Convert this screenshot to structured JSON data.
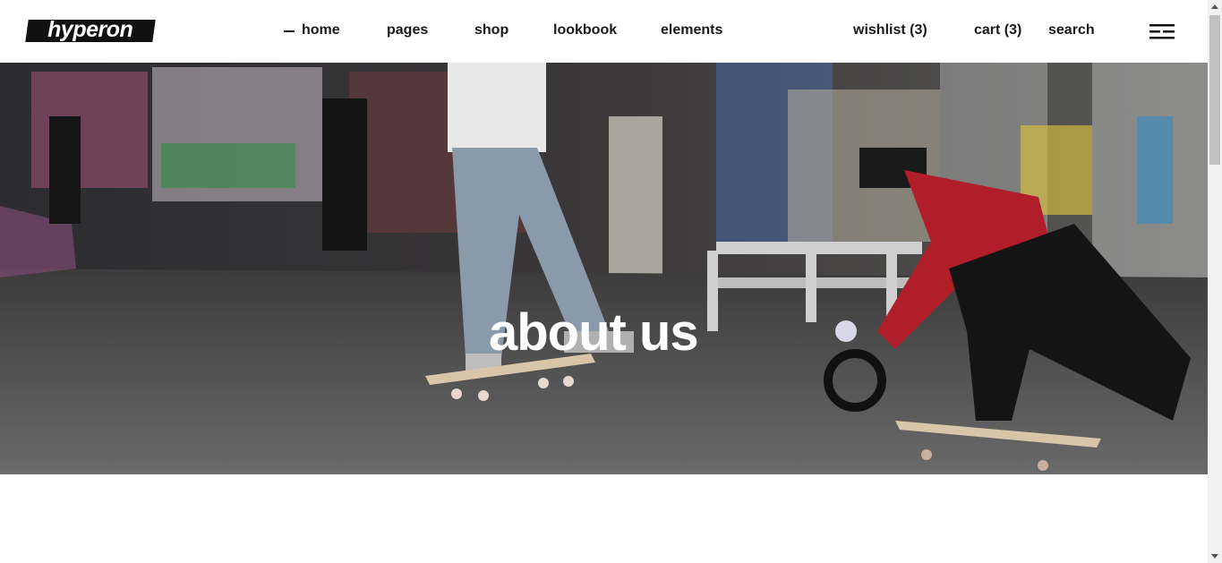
{
  "brand": {
    "logo_text": "hyperon"
  },
  "nav": {
    "home": "home",
    "pages": "pages",
    "shop": "shop",
    "lookbook": "lookbook",
    "elements": "elements",
    "wishlist": "wishlist (3)",
    "cart": "cart (3)",
    "search": "search"
  },
  "icons": {
    "menu": "hamburger-menu-icon",
    "active": "dash-indicator-icon"
  },
  "hero": {
    "title": "about us",
    "image": "skatepark-graffiti-photo"
  },
  "colors": {
    "text": "#1a1a1a",
    "logo_bg": "#111111",
    "hero_title": "#ffffff"
  }
}
